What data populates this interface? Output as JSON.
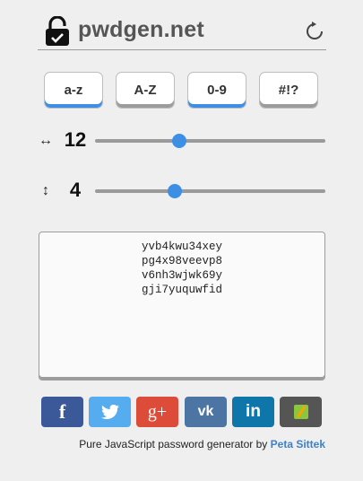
{
  "header": {
    "logo_icon": "lock-icon",
    "title": "pwdgen.net",
    "refresh_icon": "refresh-icon"
  },
  "toggles": [
    {
      "label": "a-z",
      "active": true
    },
    {
      "label": "A-Z",
      "active": false
    },
    {
      "label": "0-9",
      "active": true
    },
    {
      "label": "#!?",
      "active": false
    }
  ],
  "length": {
    "icon": "horizontal-arrows-icon",
    "symbol": "↔",
    "value": "12",
    "slider_fraction": 0.365
  },
  "count": {
    "icon": "vertical-arrows-icon",
    "symbol": "↕",
    "value": "4",
    "slider_fraction": 0.345
  },
  "passwords": [
    "yvb4kwu34xey",
    "pg4x98veevp8",
    "v6nh3wjwk69y",
    "gji7yuquwfid"
  ],
  "social": [
    {
      "name": "facebook",
      "label": "f",
      "color": "#3b5998"
    },
    {
      "name": "twitter",
      "label": "t",
      "color": "#55acee"
    },
    {
      "name": "google-plus",
      "label": "g+",
      "color": "#dd4b39"
    },
    {
      "name": "vk",
      "label": "vk",
      "color": "#4c75a3"
    },
    {
      "name": "linkedin",
      "label": "in",
      "color": "#0e76a8"
    },
    {
      "name": "other",
      "label": "",
      "color": "#555555"
    }
  ],
  "footer": {
    "text": "Pure JavaScript password generator by ",
    "author": "Peta Sittek"
  },
  "colors": {
    "accent": "#3d8fe6",
    "link": "#3d82c8",
    "background": "#efefef"
  }
}
